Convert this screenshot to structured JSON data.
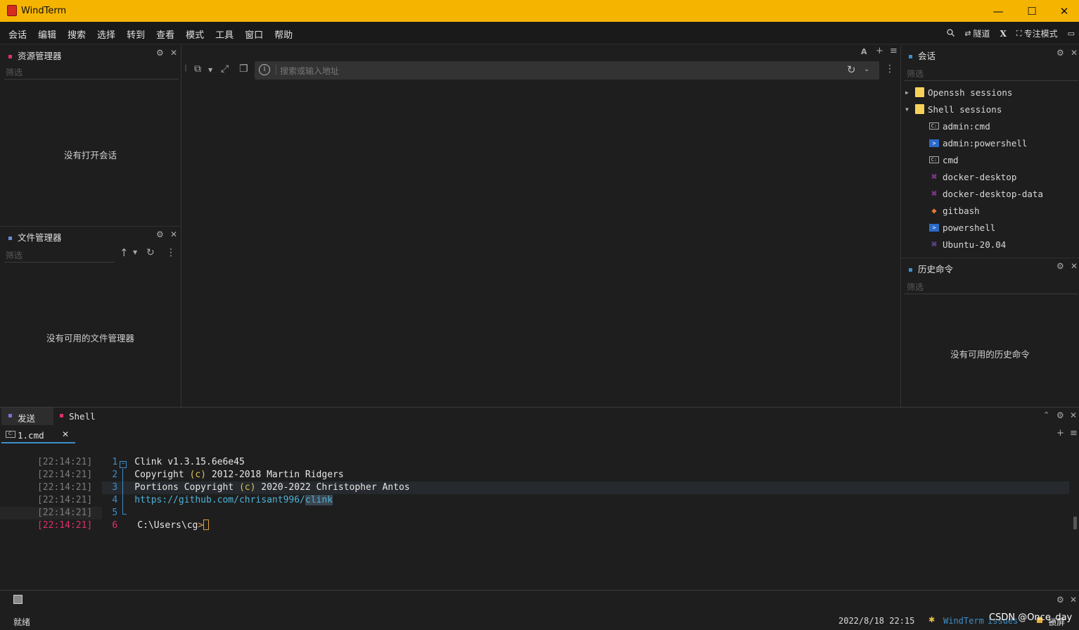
{
  "window": {
    "title": "WindTerm",
    "minimize": "—",
    "maximize": "☐",
    "close": "✕"
  },
  "menu": {
    "items": [
      "会话",
      "编辑",
      "搜索",
      "选择",
      "转到",
      "查看",
      "模式",
      "工具",
      "窗口",
      "帮助"
    ],
    "tunnel": "隧道",
    "x_label": "X",
    "focus_mode": "专注模式"
  },
  "explorer": {
    "title": "资源管理器",
    "filter_placeholder": "筛选",
    "empty": "没有打开会话"
  },
  "file_manager": {
    "title": "文件管理器",
    "filter_placeholder": "筛选",
    "empty": "没有可用的文件管理器"
  },
  "address_bar": {
    "placeholder": "搜索或输入地址",
    "font_label": "A"
  },
  "sessions": {
    "title": "会话",
    "filter_placeholder": "筛选",
    "groups": [
      {
        "label": "Openssh sessions",
        "expanded": false
      },
      {
        "label": "Shell sessions",
        "expanded": true
      }
    ],
    "items": [
      {
        "label": "admin:cmd",
        "icon": "cmd-icon"
      },
      {
        "label": "admin:powershell",
        "icon": "powershell-icon"
      },
      {
        "label": "cmd",
        "icon": "cmd-icon"
      },
      {
        "label": "docker-desktop",
        "icon": "wsl-icon"
      },
      {
        "label": "docker-desktop-data",
        "icon": "wsl-icon"
      },
      {
        "label": "gitbash",
        "icon": "git-icon"
      },
      {
        "label": "powershell",
        "icon": "powershell-icon"
      },
      {
        "label": "Ubuntu-20.04",
        "icon": "wsl-icon"
      }
    ]
  },
  "history": {
    "title": "历史命令",
    "filter_placeholder": "筛选",
    "empty": "没有可用的历史命令"
  },
  "bottom_tabs": {
    "send": "发送",
    "shell": "Shell"
  },
  "terminal": {
    "tab_label": "1.cmd",
    "lines": [
      {
        "ts": "[22:14:21]",
        "ln": "1",
        "text": "Clink v1.3.15.6e6e45"
      },
      {
        "ts": "[22:14:21]",
        "ln": "2",
        "text_parts": [
          "Copyright ",
          "(c)",
          " 2012-2018 Martin Ridgers"
        ]
      },
      {
        "ts": "[22:14:21]",
        "ln": "3",
        "text_parts": [
          "Portions Copyright ",
          "(c)",
          " 2020-2022 Christopher Antos"
        ]
      },
      {
        "ts": "[22:14:21]",
        "ln": "4",
        "text_parts": [
          "https://github.com/chrisant996/",
          "clink"
        ]
      },
      {
        "ts": "[22:14:21]",
        "ln": "5",
        "text": ""
      },
      {
        "ts": "[22:14:21]",
        "ln": "6",
        "text_parts": [
          "C:\\Users\\cg",
          ">"
        ]
      }
    ]
  },
  "status": {
    "ready": "就绪",
    "datetime": "2022/8/18 22:15",
    "windterm_link": "WindTerm",
    "issues": "issues",
    "lock": "锁屏",
    "watermark": "CSDN @Once_day"
  },
  "colors": {
    "titlebar": "#f5b400",
    "accent_blue": "#3d8fc9",
    "link": "#4fb3d9",
    "current_line": "#e0306a"
  }
}
